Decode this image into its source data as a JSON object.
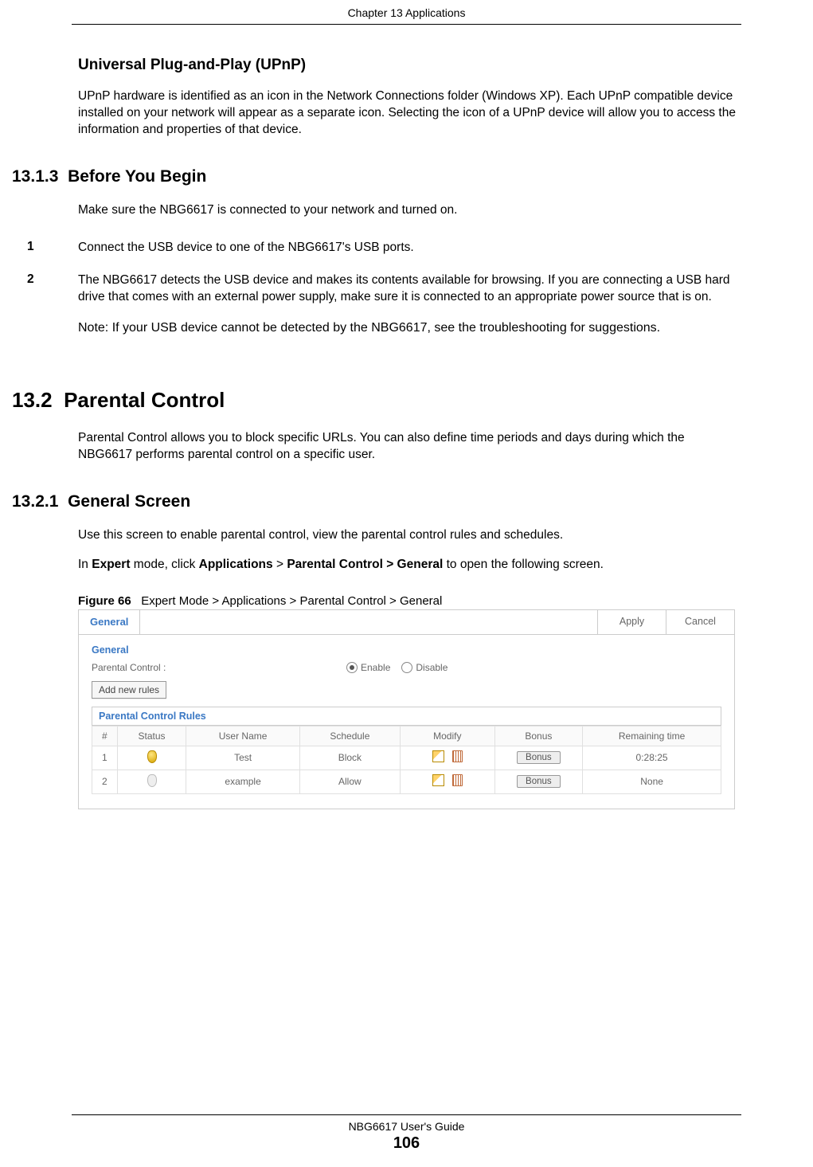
{
  "header": {
    "chapter": "Chapter 13 Applications"
  },
  "upnp": {
    "title": "Universal Plug-and-Play (UPnP)",
    "body": "UPnP hardware is identified as an icon in the Network Connections folder (Windows XP). Each UPnP compatible device installed on your network will appear as a separate icon. Selecting the icon of a UPnP device will allow you to access the information and properties of that device."
  },
  "s1313": {
    "num": "13.1.3",
    "title": "Before You Begin",
    "intro": "Make sure the NBG6617 is connected to your network and turned on.",
    "steps": [
      {
        "n": "1",
        "t": "Connect the USB device to one of the NBG6617's USB ports."
      },
      {
        "n": "2",
        "t": "The NBG6617 detects the USB device and makes its contents available for browsing. If you are connecting a USB hard drive that comes with an external power supply, make sure it is connected to an appropriate power source that is on."
      }
    ],
    "note": "Note: If your USB device cannot be detected by the NBG6617, see the troubleshooting for suggestions."
  },
  "s132": {
    "num": "13.2",
    "title": "Parental Control",
    "body": "Parental Control allows you to block specific URLs. You can also define time periods and days during which the NBG6617 performs parental control on a specific user."
  },
  "s1321": {
    "num": "13.2.1",
    "title": "General Screen",
    "p1": "Use this screen to enable parental control, view the parental control rules and schedules.",
    "p2_pre": "In ",
    "p2_b1": "Expert",
    "p2_mid1": " mode, click ",
    "p2_b2": "Applications",
    "p2_mid2": " > ",
    "p2_b3": "Parental Control > General",
    "p2_post": " to open the following screen."
  },
  "figure": {
    "label": "Figure 66",
    "caption": "Expert Mode > Applications > Parental Control > General",
    "tab": "General",
    "apply": "Apply",
    "cancel": "Cancel",
    "section1": "General",
    "pc_label": "Parental Control :",
    "enable": "Enable",
    "disable": "Disable",
    "addbtn": "Add new rules",
    "rules_title": "Parental Control Rules",
    "cols": {
      "idx": "#",
      "status": "Status",
      "user": "User Name",
      "sched": "Schedule",
      "modify": "Modify",
      "bonus": "Bonus",
      "remain": "Remaining time"
    },
    "rows": [
      {
        "idx": "1",
        "status": "on",
        "user": "Test",
        "sched": "Block",
        "bonus": "Bonus",
        "remain": "0:28:25"
      },
      {
        "idx": "2",
        "status": "off",
        "user": "example",
        "sched": "Allow",
        "bonus": "Bonus",
        "remain": "None"
      }
    ]
  },
  "footer": {
    "guide": "NBG6617 User's Guide",
    "page": "106"
  }
}
